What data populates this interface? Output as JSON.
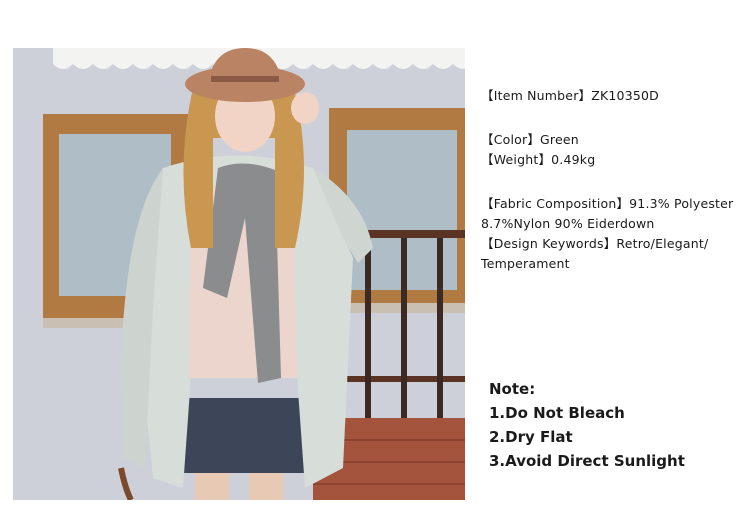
{
  "product": {
    "item_number": "【Item Number】ZK10350D",
    "color": "【Color】Green",
    "weight": "【Weight】0.49kg",
    "fabric_line1": "【Fabric Composition】91.3% Polyester",
    "fabric_line2": "8.7%Nylon  90% Eiderdown",
    "design_line1": "【Design Keywords】Retro/Elegant/",
    "design_line2": "Temperament"
  },
  "note": {
    "title": "Note:",
    "items": [
      "1.Do Not Bleach",
      "2.Dry Flat",
      "3.Avoid Direct Sunlight"
    ]
  },
  "photo": {
    "description": "model-in-coat-photo"
  },
  "colors": {
    "coat": "#d7ddd8",
    "wall": "#c9ccd6",
    "window_frame": "#b07a42",
    "brick": "#a4533d"
  }
}
